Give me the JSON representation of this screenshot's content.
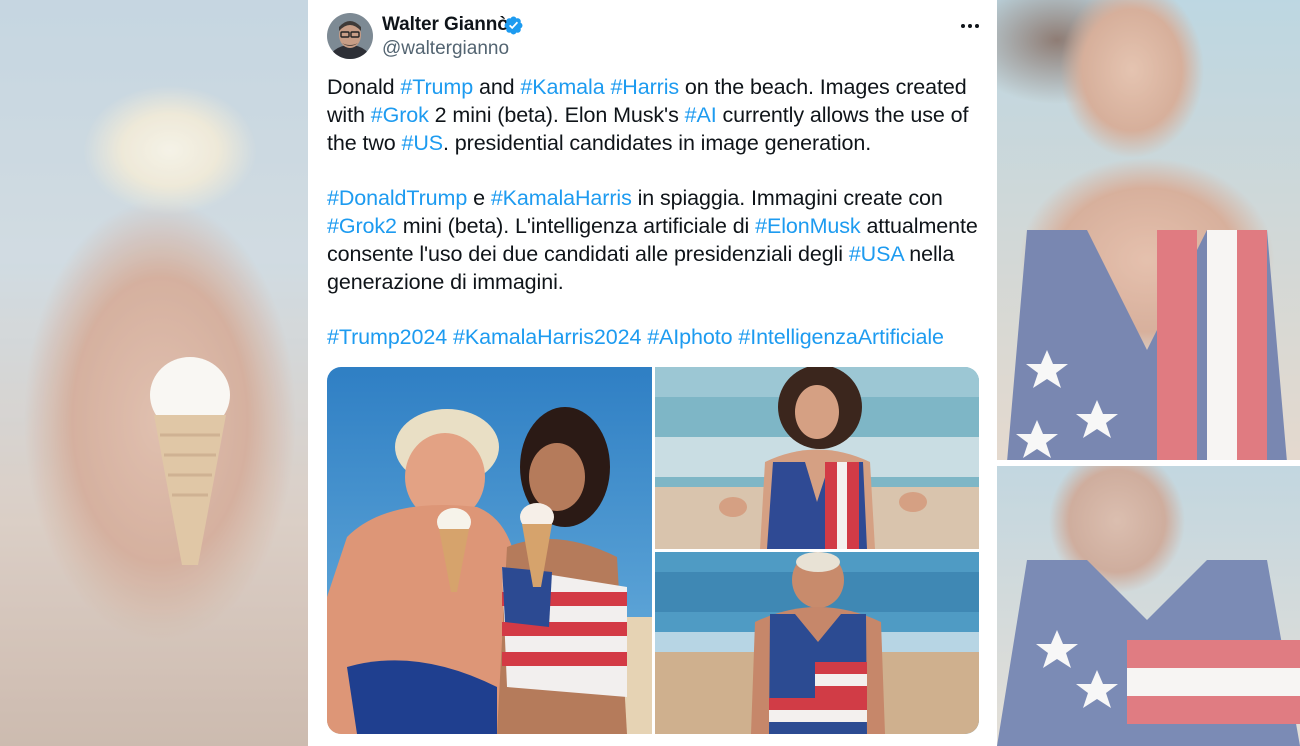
{
  "tweet": {
    "author_name": "Walter Giannò",
    "handle": "@waltergianno",
    "paragraphs": [
      [
        {
          "t": "Donald "
        },
        {
          "t": "#Trump",
          "tag": true
        },
        {
          "t": " and "
        },
        {
          "t": "#Kamala",
          "tag": true
        },
        {
          "t": " "
        },
        {
          "t": "#Harris",
          "tag": true
        },
        {
          "t": " on the beach. Images created with "
        },
        {
          "t": "#Grok",
          "tag": true
        },
        {
          "t": " 2 mini (beta). Elon Musk's "
        },
        {
          "t": "#AI",
          "tag": true
        },
        {
          "t": " currently allows the use of the two "
        },
        {
          "t": "#US",
          "tag": true
        },
        {
          "t": ". presidential candidates in image generation."
        }
      ],
      [
        {
          "t": "#DonaldTrump",
          "tag": true
        },
        {
          "t": " e "
        },
        {
          "t": "#KamalaHarris",
          "tag": true
        },
        {
          "t": " in spiaggia. Immagini create con "
        },
        {
          "t": "#Grok2",
          "tag": true
        },
        {
          "t": " mini (beta). L'intelligenza artificiale di "
        },
        {
          "t": "#ElonMusk",
          "tag": true
        },
        {
          "t": " attualmente consente l'uso dei due candidati alle presidenziali degli "
        },
        {
          "t": "#USA",
          "tag": true
        },
        {
          "t": " nella generazione di immagini."
        }
      ],
      [
        {
          "t": "#Trump2024",
          "tag": true
        },
        {
          "t": " "
        },
        {
          "t": "#KamalaHarris2024",
          "tag": true
        },
        {
          "t": " "
        },
        {
          "t": "#AIphoto",
          "tag": true
        },
        {
          "t": " "
        },
        {
          "t": "#IntelligenzaArtificiale",
          "tag": true
        }
      ]
    ],
    "media": [
      {
        "name": "beach-photo-couple-ice-cream"
      },
      {
        "name": "beach-photo-woman-flag-swimsuit"
      },
      {
        "name": "beach-photo-man-flag-tank"
      }
    ]
  },
  "icons": {
    "verified": "verified-badge-icon",
    "more": "more-options-icon"
  },
  "colors": {
    "text": "#0f1419",
    "secondary": "#536471",
    "link": "#1d9bf0",
    "verified": "#1d9bf0",
    "card_bg": "#ffffff"
  }
}
